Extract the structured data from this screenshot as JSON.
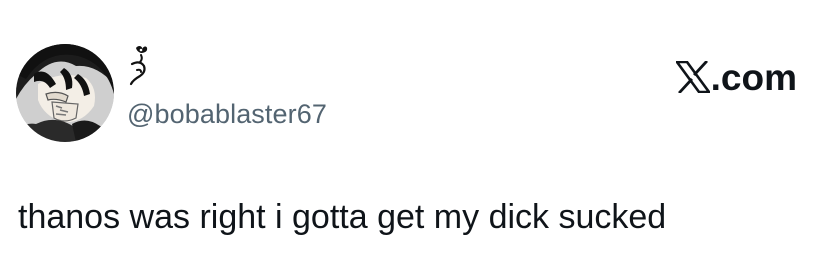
{
  "tweet": {
    "handle": "@bobablaster67",
    "text": "thanos was right i gotta get my dick sucked"
  },
  "brand": {
    "suffix": ".com"
  },
  "icons": {
    "avatar": "anime-character-avatar",
    "display_name": "emoji-display-name",
    "brand_logo": "x-logo-icon"
  },
  "colors": {
    "text_primary": "#0f1419",
    "text_secondary": "#536471",
    "background": "#ffffff"
  }
}
